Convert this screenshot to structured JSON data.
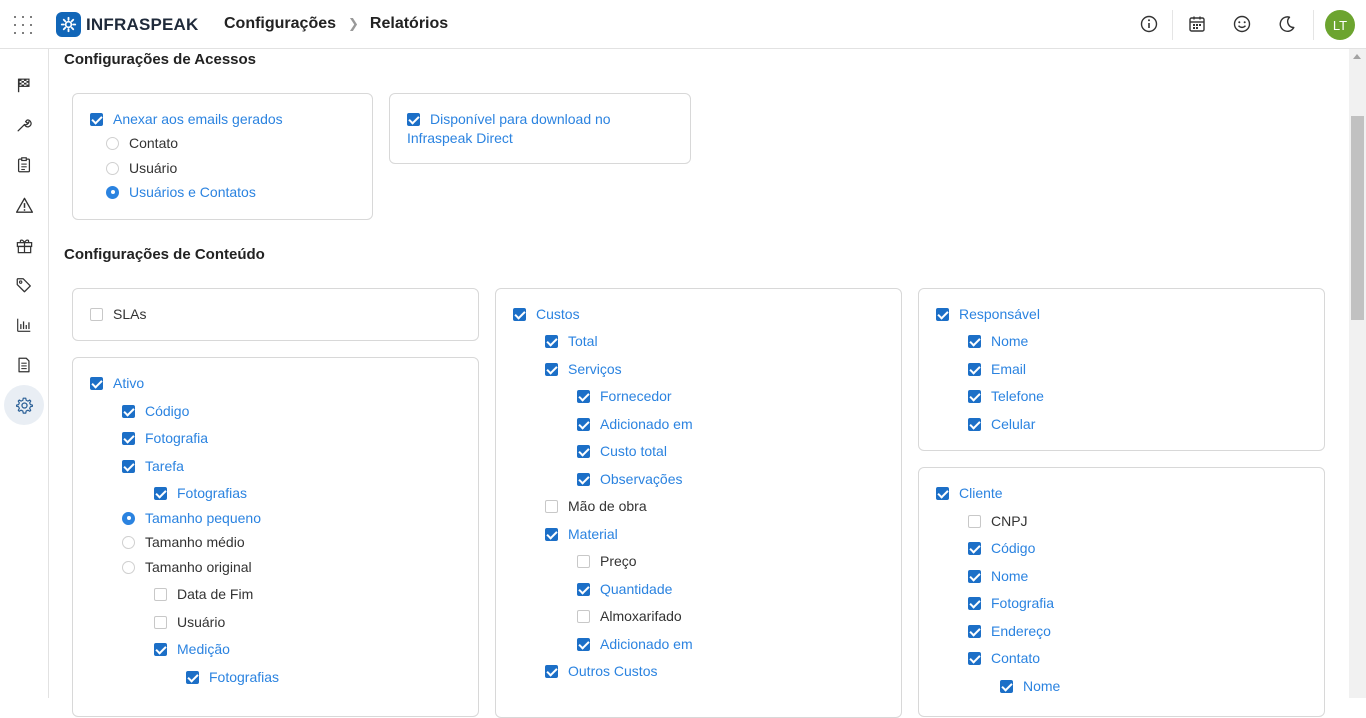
{
  "header": {
    "brand": "INFRASPEAK",
    "breadcrumb": [
      "Configurações",
      "Relatórios"
    ],
    "avatar_initials": "LT"
  },
  "colors": {
    "accent": "#2b83e0",
    "checkbox": "#1c6fc7",
    "avatar": "#6ca42f"
  },
  "sidebar_icons": [
    "flag-icon",
    "wrench-icon",
    "clipboard-icon",
    "warning-icon",
    "box-icon",
    "tag-icon",
    "chart-icon",
    "document-icon",
    "gear-icon"
  ],
  "access": {
    "title": "Configurações de Acessos",
    "email": {
      "label": "Anexar aos emails gerados",
      "checked": true,
      "options": [
        {
          "label": "Contato",
          "selected": false
        },
        {
          "label": "Usuário",
          "selected": false
        },
        {
          "label": "Usuários e Contatos",
          "selected": true
        }
      ]
    },
    "download": {
      "label": "Disponível para download no Infraspeak Direct",
      "checked": true
    }
  },
  "content": {
    "title": "Configurações de Conteúdo",
    "slas": {
      "label": "SLAs",
      "checked": false
    },
    "ativo": {
      "label": "Ativo",
      "items": [
        {
          "label": "Código",
          "type": "cb",
          "checked": true
        },
        {
          "label": "Fotografia",
          "type": "cb",
          "checked": true
        },
        {
          "label": "Tarefa",
          "type": "cb",
          "checked": true
        },
        {
          "label": "Fotografias",
          "type": "cb",
          "checked": true
        },
        {
          "label": "Tamanho pequeno",
          "type": "rb",
          "checked": true
        },
        {
          "label": "Tamanho médio",
          "type": "rb",
          "checked": false
        },
        {
          "label": "Tamanho original",
          "type": "rb",
          "checked": false
        },
        {
          "label": "Data de Fim",
          "type": "cb",
          "checked": false
        },
        {
          "label": "Usuário",
          "type": "cb",
          "checked": false
        },
        {
          "label": "Medição",
          "type": "cb",
          "checked": true
        },
        {
          "label": "Fotografias",
          "type": "cb",
          "checked": true
        }
      ]
    },
    "custos": {
      "label": "Custos",
      "items": [
        {
          "label": "Total",
          "checked": true
        },
        {
          "label": "Serviços",
          "checked": true
        },
        {
          "label": "Fornecedor",
          "checked": true
        },
        {
          "label": "Adicionado em",
          "checked": true
        },
        {
          "label": "Custo total",
          "checked": true
        },
        {
          "label": "Observações",
          "checked": true
        },
        {
          "label": "Mão de obra",
          "checked": false
        },
        {
          "label": "Material",
          "checked": true
        },
        {
          "label": "Preço",
          "checked": false
        },
        {
          "label": "Quantidade",
          "checked": true
        },
        {
          "label": "Almoxarifado",
          "checked": false
        },
        {
          "label": "Adicionado em",
          "checked": true
        },
        {
          "label": "Outros Custos",
          "checked": true
        }
      ]
    },
    "responsavel": {
      "label": "Responsável",
      "items": [
        {
          "label": "Nome",
          "checked": true
        },
        {
          "label": "Email",
          "checked": true
        },
        {
          "label": "Telefone",
          "checked": true
        },
        {
          "label": "Celular",
          "checked": true
        }
      ]
    },
    "cliente": {
      "label": "Cliente",
      "items": [
        {
          "label": "CNPJ",
          "checked": false
        },
        {
          "label": "Código",
          "checked": true
        },
        {
          "label": "Nome",
          "checked": true
        },
        {
          "label": "Fotografia",
          "checked": true
        },
        {
          "label": "Endereço",
          "checked": true
        },
        {
          "label": "Contato",
          "checked": true
        },
        {
          "label": "Nome",
          "checked": true
        }
      ]
    }
  }
}
